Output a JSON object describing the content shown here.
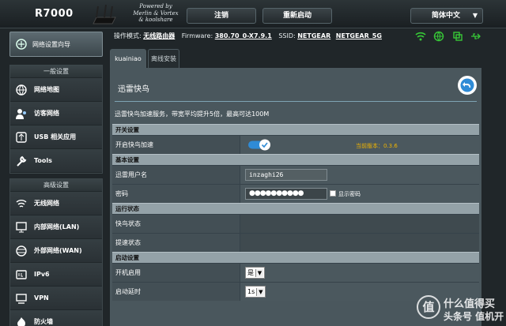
{
  "header": {
    "model": "R7000",
    "powered": [
      "Powered by",
      "Merlin & Vortex",
      "& koolshare"
    ],
    "logout": "注销",
    "reboot": "重新启动",
    "language": "简体中文"
  },
  "sidebar": {
    "wizard": "网络设置向导",
    "general_title": "一般设置",
    "general": [
      {
        "label": "网络地图",
        "icon": "network-map-icon"
      },
      {
        "label": "访客网络",
        "icon": "guest-network-icon"
      },
      {
        "label": "USB 相关应用",
        "icon": "usb-apps-icon"
      },
      {
        "label": "Tools",
        "icon": "tools-icon"
      }
    ],
    "advanced_title": "高级设置",
    "advanced": [
      {
        "label": "无线网络",
        "icon": "wireless-icon"
      },
      {
        "label": "内部网络(LAN)",
        "icon": "lan-icon"
      },
      {
        "label": "外部网络(WAN)",
        "icon": "wan-icon"
      },
      {
        "label": "IPv6",
        "icon": "ipv6-icon"
      },
      {
        "label": "VPN",
        "icon": "vpn-icon"
      },
      {
        "label": "防火墙",
        "icon": "firewall-icon"
      }
    ]
  },
  "status": {
    "mode_label": "操作模式:",
    "mode": "无线路由器",
    "fw_label": "Firmware:",
    "fw": "380.70_0-X7.9.1",
    "ssid_label": "SSID:",
    "ssid1": "NETGEAR",
    "ssid2": "NETGEAR_5G"
  },
  "tabs": [
    {
      "label": "kuainiao"
    },
    {
      "label": "离线安装"
    }
  ],
  "page": {
    "title": "迅雷快鸟",
    "description": "迅雷快鸟加速服务，带宽平均提升5倍，最高可达100M"
  },
  "sections": {
    "switch": {
      "title": "开关设置",
      "enable_label": "开启快鸟加速",
      "enabled": true,
      "version": "当前版本：0.3.6"
    },
    "basic": {
      "title": "基本设置",
      "user_label": "迅雷用户名",
      "user_value": "inzaghi26",
      "pw_label": "密码",
      "pw_value": "●●●●●●●●●●",
      "show_pw": "显示密码"
    },
    "run": {
      "title": "运行状态",
      "state1": "快鸟状态",
      "state2": "提速状态"
    },
    "startup": {
      "title": "启动设置",
      "boot_label": "开机启用",
      "boot_value": "是",
      "delay_label": "启动延时",
      "delay_value": "1s"
    }
  },
  "watermark": {
    "line1": "什么值得买",
    "line2": "头条号 值机开"
  },
  "colors": {
    "accent": "#2f8bd6",
    "warning": "#f0b400",
    "green": "#37c837"
  }
}
